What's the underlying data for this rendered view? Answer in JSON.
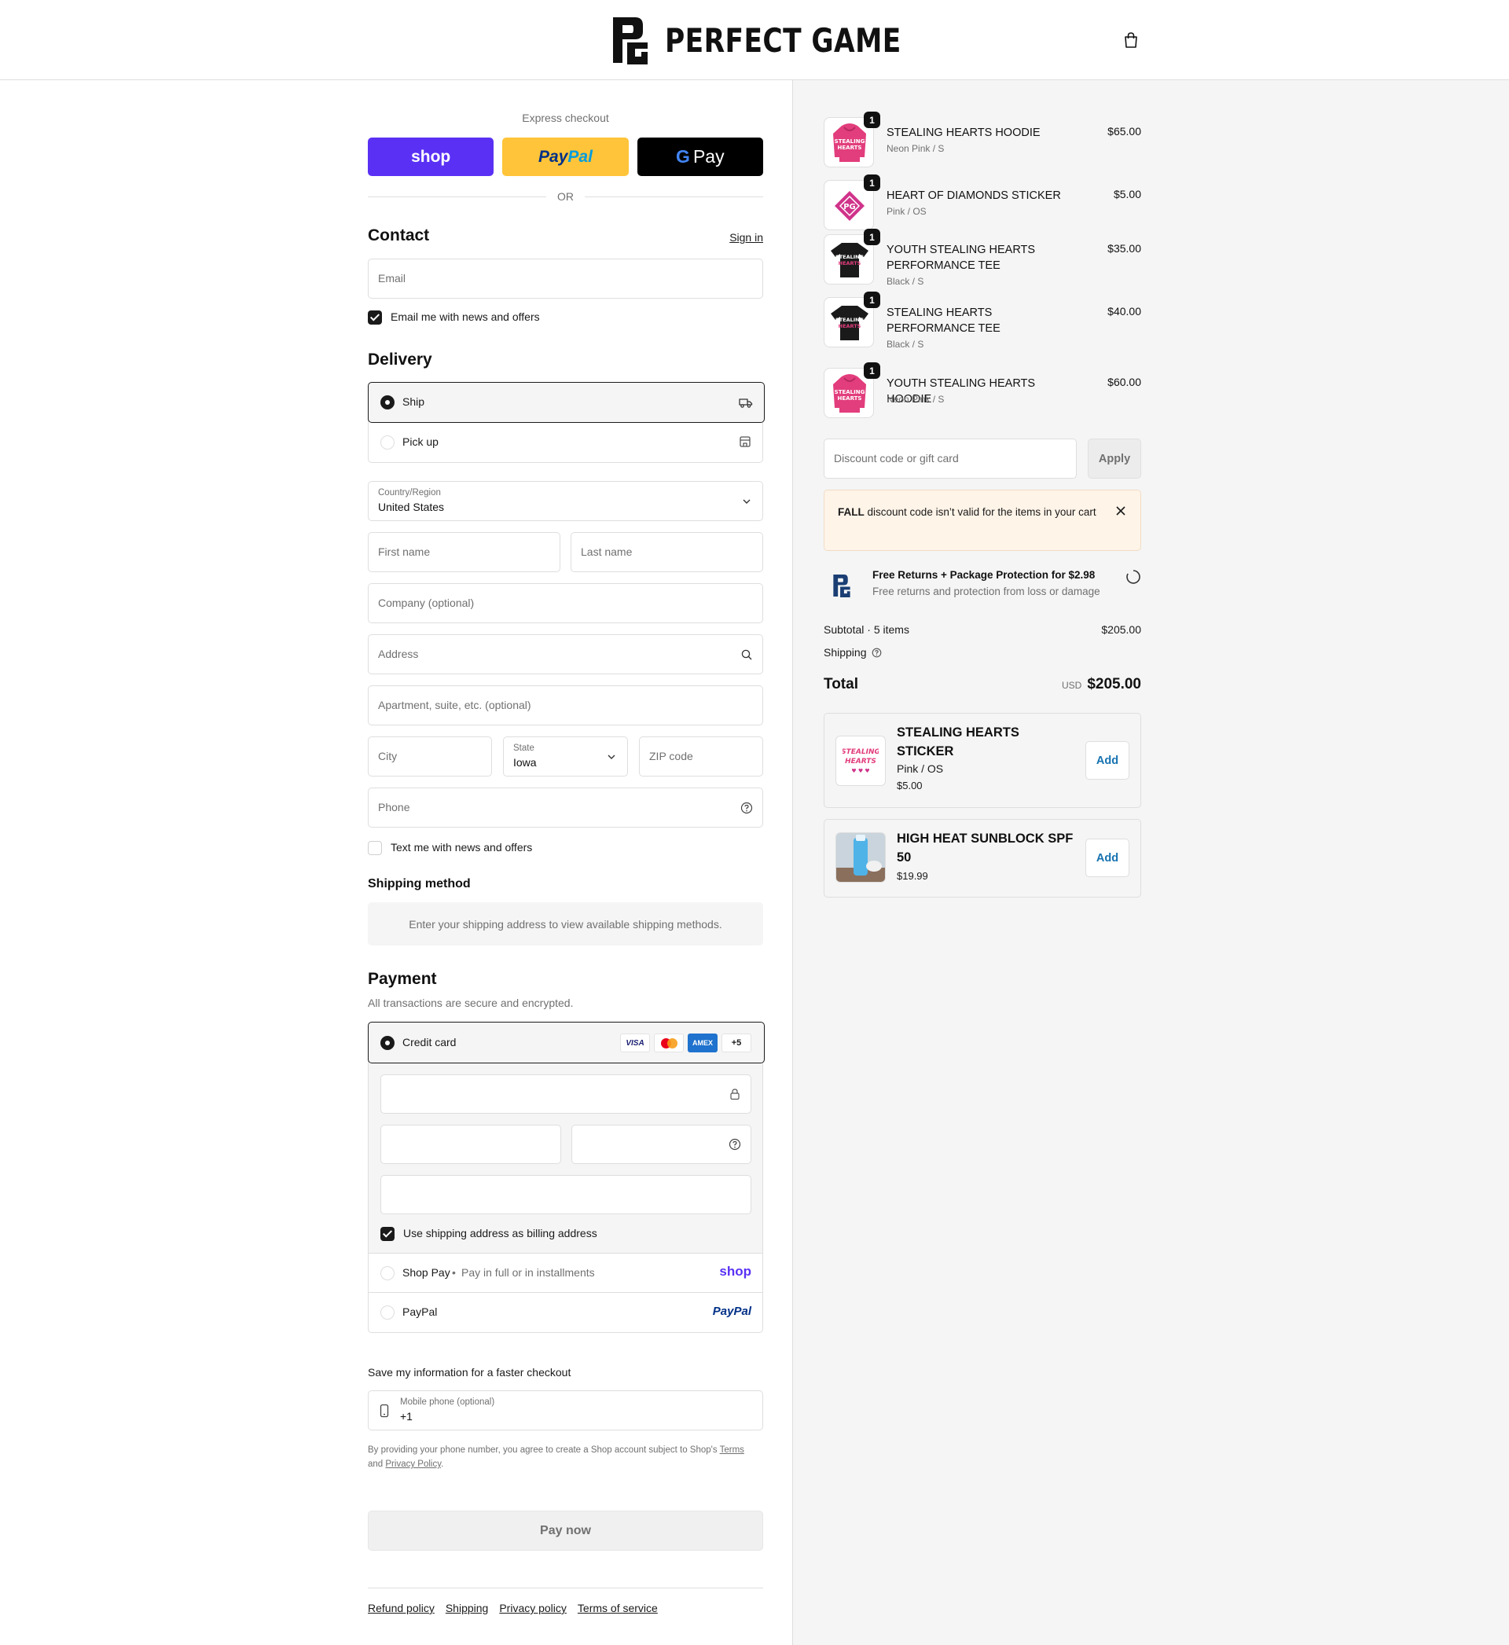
{
  "header": {
    "brand": "PERFECT GAME"
  },
  "express": {
    "label": "Express checkout",
    "shop": "shop",
    "paypal_a": "Pay",
    "paypal_b": "Pal",
    "gpay_g": "G",
    "gpay": "Pay",
    "or": "OR"
  },
  "contact": {
    "title": "Contact",
    "sign_in": "Sign in",
    "email_placeholder": "Email",
    "news_label": "Email me with news and offers",
    "news_checked": true
  },
  "delivery": {
    "title": "Delivery",
    "options": [
      {
        "label": "Ship",
        "selected": true,
        "icon": "truck-icon"
      },
      {
        "label": "Pick up",
        "selected": false,
        "icon": "store-icon"
      }
    ],
    "country_label": "Country/Region",
    "country_value": "United States",
    "first_name": "First name",
    "last_name": "Last name",
    "company": "Company (optional)",
    "address": "Address",
    "apartment": "Apartment, suite, etc. (optional)",
    "city": "City",
    "state_label": "State",
    "state_value": "Iowa",
    "zip": "ZIP code",
    "phone": "Phone",
    "text_label": "Text me with news and offers",
    "text_checked": false
  },
  "shipping_method": {
    "title": "Shipping method",
    "message": "Enter your shipping address to view available shipping methods."
  },
  "payment": {
    "title": "Payment",
    "subtitle": "All transactions are secure and encrypted.",
    "credit_card": "Credit card",
    "card_brands": [
      "VISA",
      "mastercard",
      "AMEX"
    ],
    "more_brands": "+5",
    "billing_label": "Use shipping address as billing address",
    "billing_checked": true,
    "shop_pay": "Shop Pay",
    "shop_pay_sub": "Pay in full or in installments",
    "shop_pay_logo": "shop",
    "paypal": "PayPal",
    "paypal_logo": "PayPal"
  },
  "save_info": {
    "title": "Save my information for a faster checkout",
    "mobile_label": "Mobile phone (optional)",
    "mobile_value": "+1",
    "legal_pre": "By providing your phone number, you agree to create a Shop account subject to Shop's",
    "terms": "Terms",
    "and": "and",
    "privacy": "Privacy Policy",
    "period": "."
  },
  "pay_now": "Pay now",
  "footer_links": [
    "Refund policy",
    "Shipping",
    "Privacy policy",
    "Terms of service"
  ],
  "cart": {
    "items": [
      {
        "name": "STEALING HEARTS HOODIE",
        "variant": "Neon Pink / S",
        "price": "$65.00",
        "qty": "1",
        "color": "#e23d7c"
      },
      {
        "name": "HEART OF DIAMONDS STICKER",
        "variant": "Pink / OS",
        "price": "$5.00",
        "qty": "1",
        "color": "#d0338a"
      },
      {
        "name": "YOUTH STEALING HEARTS PERFORMANCE TEE",
        "variant": "Black / S",
        "price": "$35.00",
        "qty": "1",
        "color": "#1a1a1a"
      },
      {
        "name": "STEALING HEARTS PERFORMANCE TEE",
        "variant": "Black / S",
        "price": "$40.00",
        "qty": "1",
        "color": "#1a1a1a"
      },
      {
        "name": "YOUTH STEALING HEARTS HOODIE",
        "variant": "Neon Pink / S",
        "price": "$60.00",
        "qty": "1",
        "color": "#e23d7c"
      }
    ],
    "discount_placeholder": "Discount code or gift card",
    "apply": "Apply",
    "error_code": "FALL",
    "error_msg": "discount code isn’t valid for the items in your cart",
    "protection_title": "Free Returns + Package Protection for $2.98",
    "protection_sub": "Free returns and protection from loss or damage",
    "subtotal_label": "Subtotal · 5 items",
    "subtotal": "$205.00",
    "shipping_label": "Shipping",
    "total_label": "Total",
    "currency": "USD",
    "total": "$205.00"
  },
  "upsells": [
    {
      "name": "STEALING HEARTS STICKER",
      "variant": "Pink / OS",
      "price": "$5.00",
      "add": "Add"
    },
    {
      "name": "HIGH HEAT SUNBLOCK SPF 50",
      "price": "$19.99",
      "add": "Add"
    }
  ]
}
